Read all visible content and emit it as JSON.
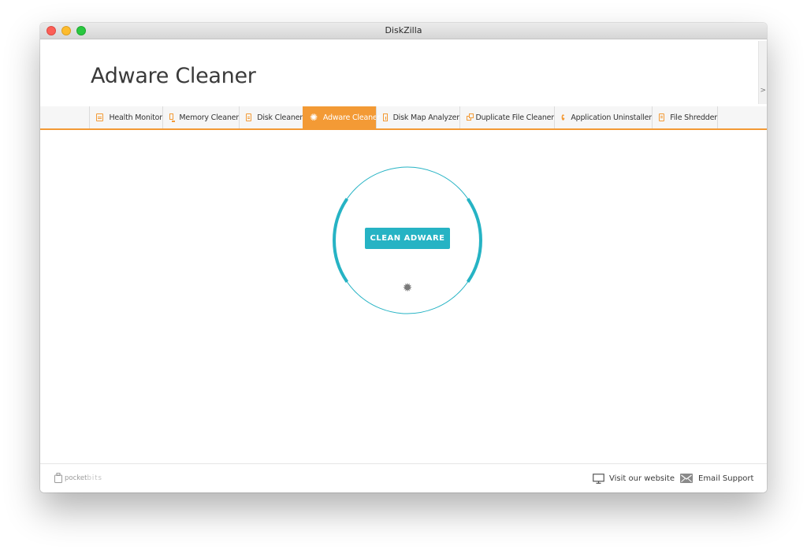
{
  "window": {
    "title": "DiskZilla"
  },
  "page": {
    "title": "Adware Cleaner"
  },
  "side_panel": {
    "arrow": ">"
  },
  "tabs": [
    {
      "label": "Health Monitor",
      "icon": "health-monitor-icon"
    },
    {
      "label": "Memory Cleaner",
      "icon": "memory-cleaner-icon"
    },
    {
      "label": "Disk Cleaner",
      "icon": "disk-cleaner-icon"
    },
    {
      "label": "Adware Cleaner",
      "icon": "adware-bug-icon",
      "active": true
    },
    {
      "label": "Disk Map Analyzer",
      "icon": "disk-map-icon"
    },
    {
      "label": "Duplicate File Cleaner",
      "icon": "duplicate-file-icon"
    },
    {
      "label": "Application Uninstaller",
      "icon": "gear-icon"
    },
    {
      "label": "File Shredder",
      "icon": "file-shredder-icon"
    }
  ],
  "main": {
    "action_label": "CLEAN ADWARE",
    "settings_icon": "gear-icon"
  },
  "footer": {
    "brand": {
      "name_a": "pocket",
      "name_b": "bits"
    },
    "website_label": "Visit our website",
    "support_label": "Email Support"
  },
  "colors": {
    "accent": "#f39a35",
    "teal": "#26b3c4"
  }
}
